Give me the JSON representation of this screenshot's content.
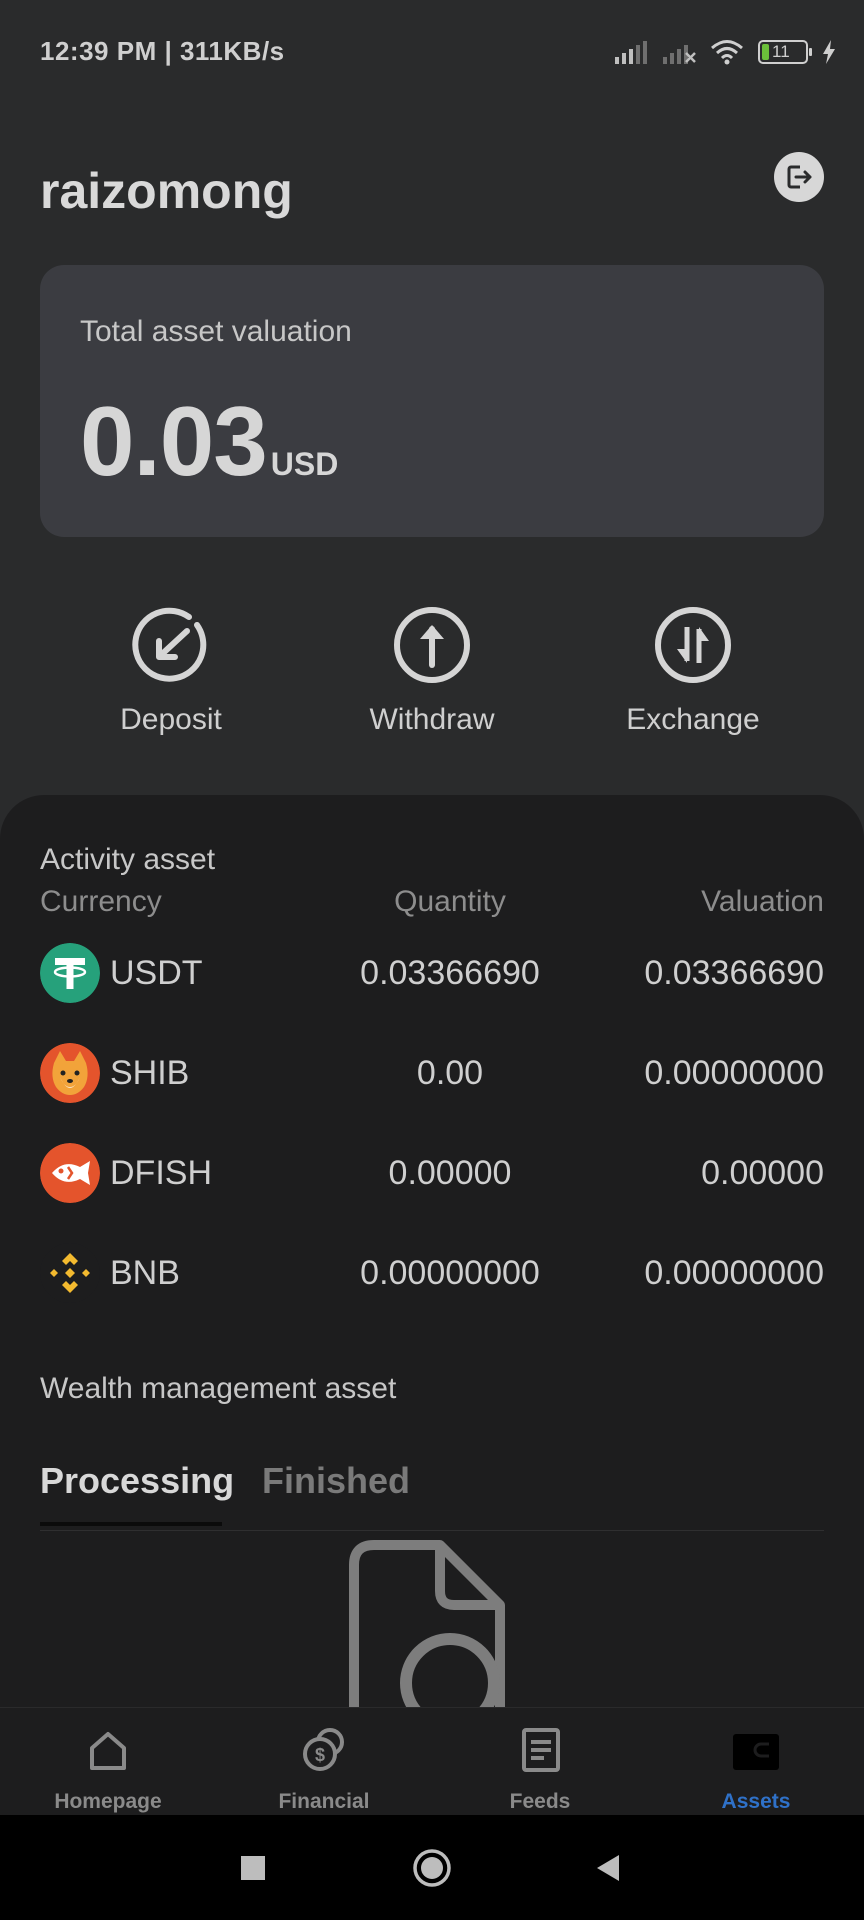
{
  "status_bar": {
    "time": "12:39 PM | 311KB/s",
    "battery_level": "11"
  },
  "header": {
    "username": "raizomong"
  },
  "asset_card": {
    "label": "Total asset valuation",
    "amount": "0.03",
    "currency": "USD"
  },
  "actions": [
    {
      "label": "Deposit",
      "icon": "deposit-icon"
    },
    {
      "label": "Withdraw",
      "icon": "withdraw-icon"
    },
    {
      "label": "Exchange",
      "icon": "exchange-icon"
    }
  ],
  "activity": {
    "title": "Activity asset",
    "columns": [
      "Currency",
      "Quantity",
      "Valuation"
    ],
    "rows": [
      {
        "symbol": "USDT",
        "quantity": "0.03366690",
        "valuation": "0.03366690",
        "icon_color": "#26a17b"
      },
      {
        "symbol": "SHIB",
        "quantity": "0.00",
        "valuation": "0.00000000",
        "icon_color": "#e4542c"
      },
      {
        "symbol": "DFISH",
        "quantity": "0.00000",
        "valuation": "0.00000",
        "icon_color": "#e4542c"
      },
      {
        "symbol": "BNB",
        "quantity": "0.00000000",
        "valuation": "0.00000000",
        "icon_color": "#f3ba2f"
      }
    ]
  },
  "wealth": {
    "title": "Wealth management asset",
    "tabs": [
      {
        "label": "Processing",
        "active": true
      },
      {
        "label": "Finished",
        "active": false
      }
    ]
  },
  "bottom_nav": {
    "items": [
      {
        "label": "Homepage",
        "icon": "home-icon",
        "active": false
      },
      {
        "label": "Financial",
        "icon": "financial-icon",
        "active": false
      },
      {
        "label": "Feeds",
        "icon": "feeds-icon",
        "active": false
      },
      {
        "label": "Assets",
        "icon": "wallet-icon",
        "active": true
      }
    ],
    "active_color": "#2f71c8"
  }
}
